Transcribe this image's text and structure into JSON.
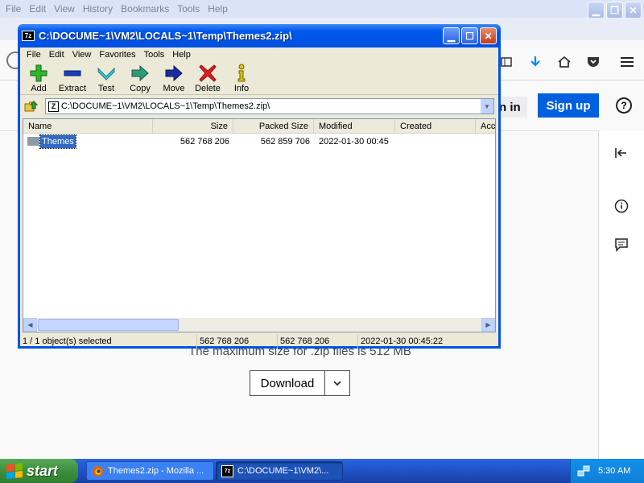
{
  "firefox": {
    "menu": [
      "File",
      "Edit",
      "View",
      "History",
      "Bookmarks",
      "Tools",
      "Help"
    ],
    "signin_label": "n in",
    "signup_label": "Sign up",
    "help_glyph": "?",
    "max_size_text": "The maximum size for .zip files is 512 MB",
    "download_label": "Download"
  },
  "zip": {
    "title": "C:\\DOCUME~1\\VM2\\LOCALS~1\\Temp\\Themes2.zip\\",
    "icon_label": "7z",
    "menu": [
      "File",
      "Edit",
      "View",
      "Favorites",
      "Tools",
      "Help"
    ],
    "toolbar": [
      "Add",
      "Extract",
      "Test",
      "Copy",
      "Move",
      "Delete",
      "Info"
    ],
    "path": "C:\\DOCUME~1\\VM2\\LOCALS~1\\Temp\\Themes2.zip\\",
    "path_icon_label": "Z",
    "columns": [
      "Name",
      "Size",
      "Packed Size",
      "Modified",
      "Created",
      "Acce"
    ],
    "rows": [
      {
        "name": "Themes",
        "size": "562 768 206",
        "packed": "562 859 706",
        "modified": "2022-01-30 00:45",
        "created": ""
      }
    ],
    "status": {
      "selection": "1 / 1 object(s) selected",
      "size": "562 768 206",
      "packed": "562 768 206",
      "modified": "2022-01-30 00:45:22"
    }
  },
  "taskbar": {
    "start_label": "start",
    "tasks": [
      "Themes2.zip - Mozilla ...",
      "C:\\DOCUME~1\\VM2\\..."
    ],
    "task_7zip_icon_label": "7z",
    "clock": "5:30 AM"
  },
  "colors": {
    "xp_blue": "#0054e3",
    "firefox_blue": "#0060df",
    "start_green": "#3c8f3c",
    "selection_blue": "#316ac5"
  }
}
